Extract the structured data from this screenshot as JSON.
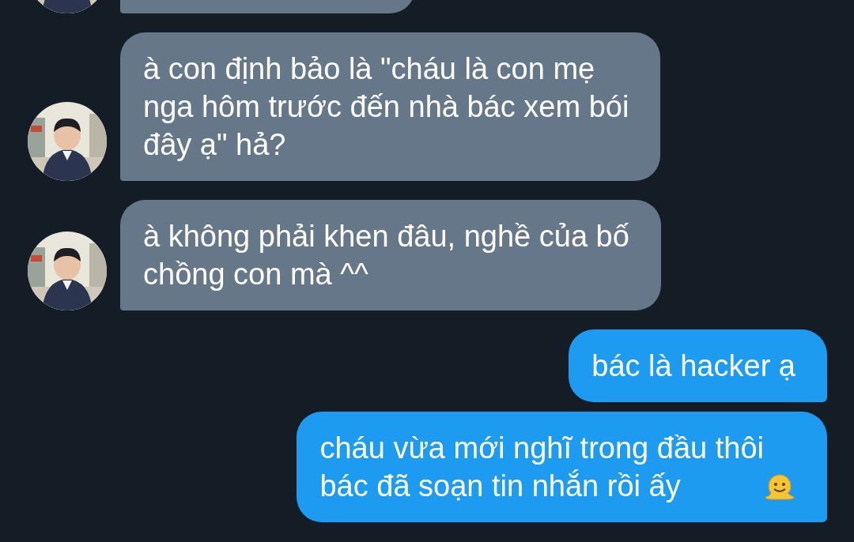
{
  "messages": [
    {
      "kind": "received"
    },
    {
      "kind": "received",
      "lines": [
        "à con định bảo là \"cháu là con mẹ",
        "nga hôm trước đến nhà bác xem bói",
        "đây ạ\" hả?"
      ]
    },
    {
      "kind": "received",
      "lines": [
        "à không phải khen đâu, nghề của bố",
        "chồng con mà ^^"
      ]
    },
    {
      "kind": "sent",
      "lines": [
        "bác là hacker ạ"
      ]
    },
    {
      "kind": "sent",
      "lines": [
        "cháu vừa mới nghĩ trong đầu thôi",
        "bác đã soạn tin nhắn rồi ấy"
      ],
      "emoji": true
    }
  ]
}
